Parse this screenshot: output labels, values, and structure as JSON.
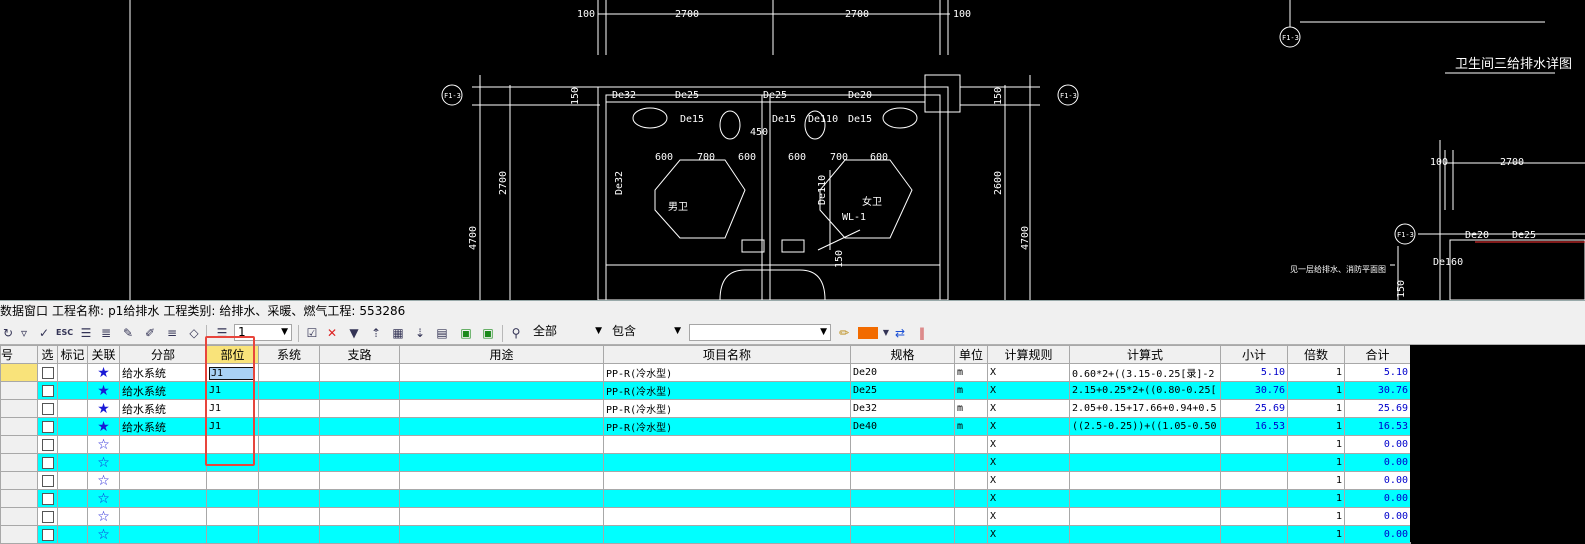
{
  "cad": {
    "dims_top": [
      "100",
      "2700",
      "2700",
      "100"
    ],
    "dims_vertical": [
      "150",
      "2700",
      "4700",
      "2600",
      "4700",
      "150",
      "150"
    ],
    "dims_mid": [
      "600",
      "700",
      "600",
      "600",
      "700",
      "600",
      "450"
    ],
    "pipe_labels": [
      "De32",
      "De25",
      "De25",
      "De20",
      "De15",
      "De15",
      "De110",
      "De15",
      "De15",
      "De32",
      "De110",
      "WL-1"
    ],
    "room_labels": [
      "男卫",
      "女卫"
    ],
    "axis_labels": [
      "F1-3",
      "F1-3",
      "F1-3",
      "F1-3",
      "F1-3"
    ],
    "title": "卫生间三给排水详图",
    "right_dims": [
      "100",
      "2700"
    ],
    "right_pipe_labels": [
      "De20",
      "De25",
      "De160"
    ],
    "right_note": "见一层给排水、消防平面图",
    "right_vertical_dim": "150"
  },
  "info_bar": {
    "window_label": "数据窗口",
    "project_label": "工程名称:",
    "project_name": "p1给排水",
    "category_label": "工程类别:",
    "category_value": "给排水、采暖、燃气工程:",
    "code": "553286"
  },
  "toolbar": {
    "level_value": "1",
    "scope_value": "全部",
    "match_value": "包含",
    "search_value": "",
    "accent_color": "#f26b00"
  },
  "grid": {
    "columns": [
      "号",
      "选",
      "标记",
      "关联",
      "分部",
      "部位",
      "系统",
      "支路",
      "用途",
      "项目名称",
      "规格",
      "单位",
      "计算规则",
      "计算式",
      "小计",
      "倍数",
      "合计"
    ],
    "rows": [
      {
        "fenbu": "给水系统",
        "buwei": "J1",
        "name": "PP-R(冷水型)",
        "spec": "De20",
        "unit": "m",
        "rule": "X",
        "formula": "0.60*2+((3.15-0.25[录]-2",
        "subtotal": "5.10",
        "mult": "1",
        "total": "5.10",
        "star": "★"
      },
      {
        "fenbu": "给水系统",
        "buwei": "J1",
        "name": "PP-R(冷水型)",
        "spec": "De25",
        "unit": "m",
        "rule": "X",
        "formula": "2.15+0.25*2+((0.80-0.25[",
        "subtotal": "30.76",
        "mult": "1",
        "total": "30.76",
        "star": "★"
      },
      {
        "fenbu": "给水系统",
        "buwei": "J1",
        "name": "PP-R(冷水型)",
        "spec": "De32",
        "unit": "m",
        "rule": "X",
        "formula": "2.05+0.15+17.66+0.94+0.5",
        "subtotal": "25.69",
        "mult": "1",
        "total": "25.69",
        "star": "★"
      },
      {
        "fenbu": "给水系统",
        "buwei": "J1",
        "name": "PP-R(冷水型)",
        "spec": "De40",
        "unit": "m",
        "rule": "X",
        "formula": "((2.5-0.25))+((1.05-0.50",
        "subtotal": "16.53",
        "mult": "1",
        "total": "16.53",
        "star": "★"
      },
      {
        "fenbu": "",
        "buwei": "",
        "name": "",
        "spec": "",
        "unit": "",
        "rule": "X",
        "formula": "",
        "subtotal": "",
        "mult": "1",
        "total": "0.00",
        "star": "☆"
      },
      {
        "fenbu": "",
        "buwei": "",
        "name": "",
        "spec": "",
        "unit": "",
        "rule": "X",
        "formula": "",
        "subtotal": "",
        "mult": "1",
        "total": "0.00",
        "star": "☆"
      },
      {
        "fenbu": "",
        "buwei": "",
        "name": "",
        "spec": "",
        "unit": "",
        "rule": "X",
        "formula": "",
        "subtotal": "",
        "mult": "1",
        "total": "0.00",
        "star": "☆"
      },
      {
        "fenbu": "",
        "buwei": "",
        "name": "",
        "spec": "",
        "unit": "",
        "rule": "X",
        "formula": "",
        "subtotal": "",
        "mult": "1",
        "total": "0.00",
        "star": "☆"
      },
      {
        "fenbu": "",
        "buwei": "",
        "name": "",
        "spec": "",
        "unit": "",
        "rule": "X",
        "formula": "",
        "subtotal": "",
        "mult": "1",
        "total": "0.00",
        "star": "☆"
      },
      {
        "fenbu": "",
        "buwei": "",
        "name": "",
        "spec": "",
        "unit": "",
        "rule": "X",
        "formula": "",
        "subtotal": "",
        "mult": "1",
        "total": "0.00",
        "star": "☆"
      }
    ]
  }
}
